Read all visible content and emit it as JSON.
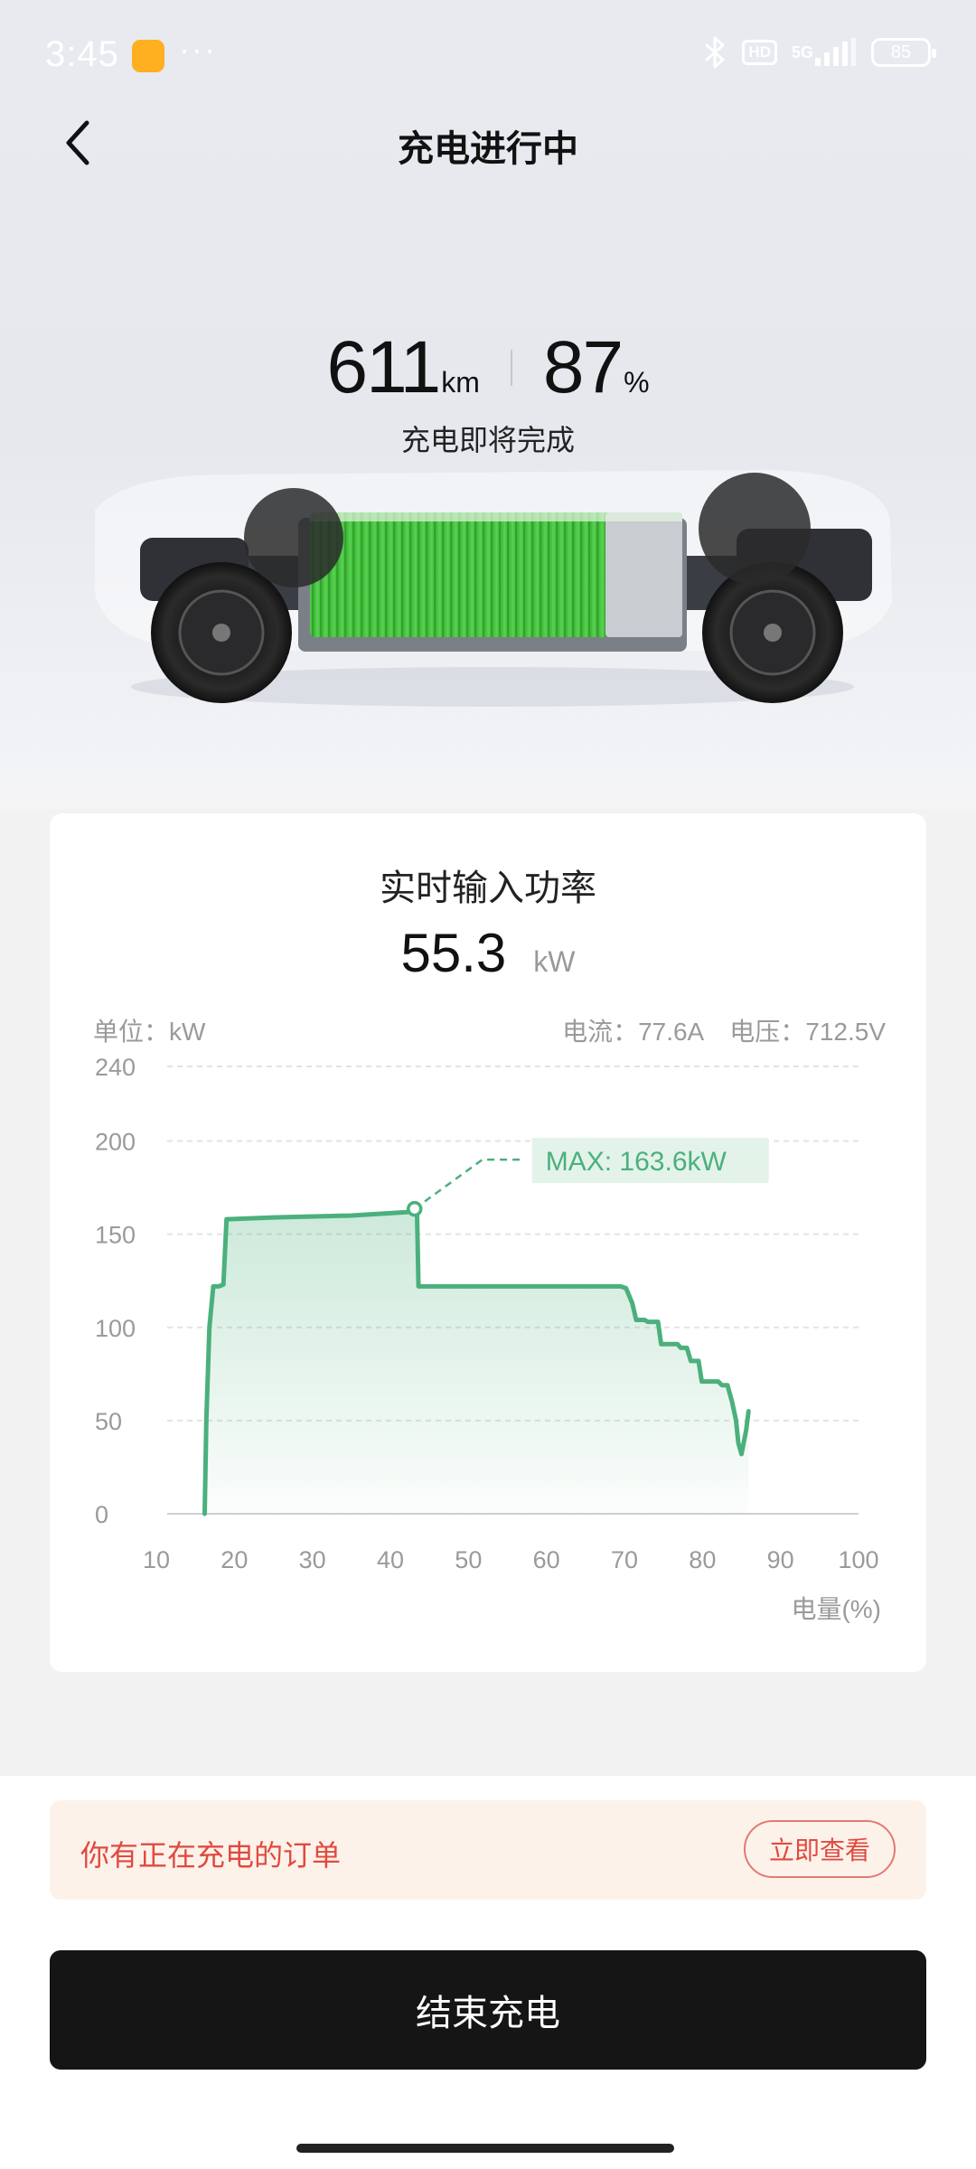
{
  "status_bar": {
    "time": "3:45",
    "more": "···",
    "hd": "HD",
    "network": "5G",
    "battery": "85"
  },
  "header": {
    "title": "充电进行中"
  },
  "stats": {
    "range_value": "611",
    "range_unit": "km",
    "soc_value": "87",
    "soc_unit": "%",
    "status": "充电即将完成"
  },
  "power_card": {
    "title": "实时输入功率",
    "value": "55.3",
    "unit": "kW",
    "unit_label": "单位：kW",
    "current": "电流：77.6A",
    "voltage": "电压：712.5V"
  },
  "chart_data": {
    "type": "line",
    "title": "实时输入功率",
    "xlabel": "电量(%)",
    "ylabel": "单位：kW",
    "xlim": [
      10,
      100
    ],
    "ylim": [
      0,
      240
    ],
    "x_ticks": [
      10,
      20,
      30,
      40,
      50,
      60,
      70,
      80,
      90,
      100
    ],
    "y_ticks": [
      0,
      50,
      100,
      150,
      200,
      240
    ],
    "grid": true,
    "annotation": "MAX: 163.6kW",
    "max_point": {
      "x": 43.1,
      "y": 163.6
    },
    "series": [
      {
        "color": "#4bb07c",
        "x": [
          16.2,
          16.4,
          16.8,
          17.3,
          18.0,
          18.6,
          19.0,
          25,
          35,
          42.8,
          43.1,
          43.4,
          43.6,
          50,
          60,
          69.5,
          70.2,
          71.0,
          71.5,
          72.6,
          73.0,
          74.3,
          74.7,
          76.8,
          77.2,
          78.0,
          78.5,
          79.5,
          79.9,
          82.0,
          82.5,
          83.2,
          83.8,
          84.3,
          84.6,
          85.0,
          85.6,
          85.9
        ],
        "y": [
          0,
          50,
          100,
          122,
          122,
          123,
          158,
          159,
          160,
          162,
          163.6,
          163,
          122,
          122,
          122,
          122,
          121,
          113,
          104,
          104,
          103,
          103,
          91,
          91,
          89,
          89,
          82,
          82,
          71,
          71,
          69,
          69,
          60,
          50,
          38,
          32,
          45,
          55
        ]
      }
    ]
  },
  "order_banner": {
    "text": "你有正在充电的订单",
    "button": "立即查看"
  },
  "footer": {
    "stop_button": "结束充电"
  },
  "colors": {
    "accent_green": "#4bb07c",
    "battery_green": "#3fc43a",
    "warning_red": "#e04a40",
    "dark_button": "#151515"
  }
}
